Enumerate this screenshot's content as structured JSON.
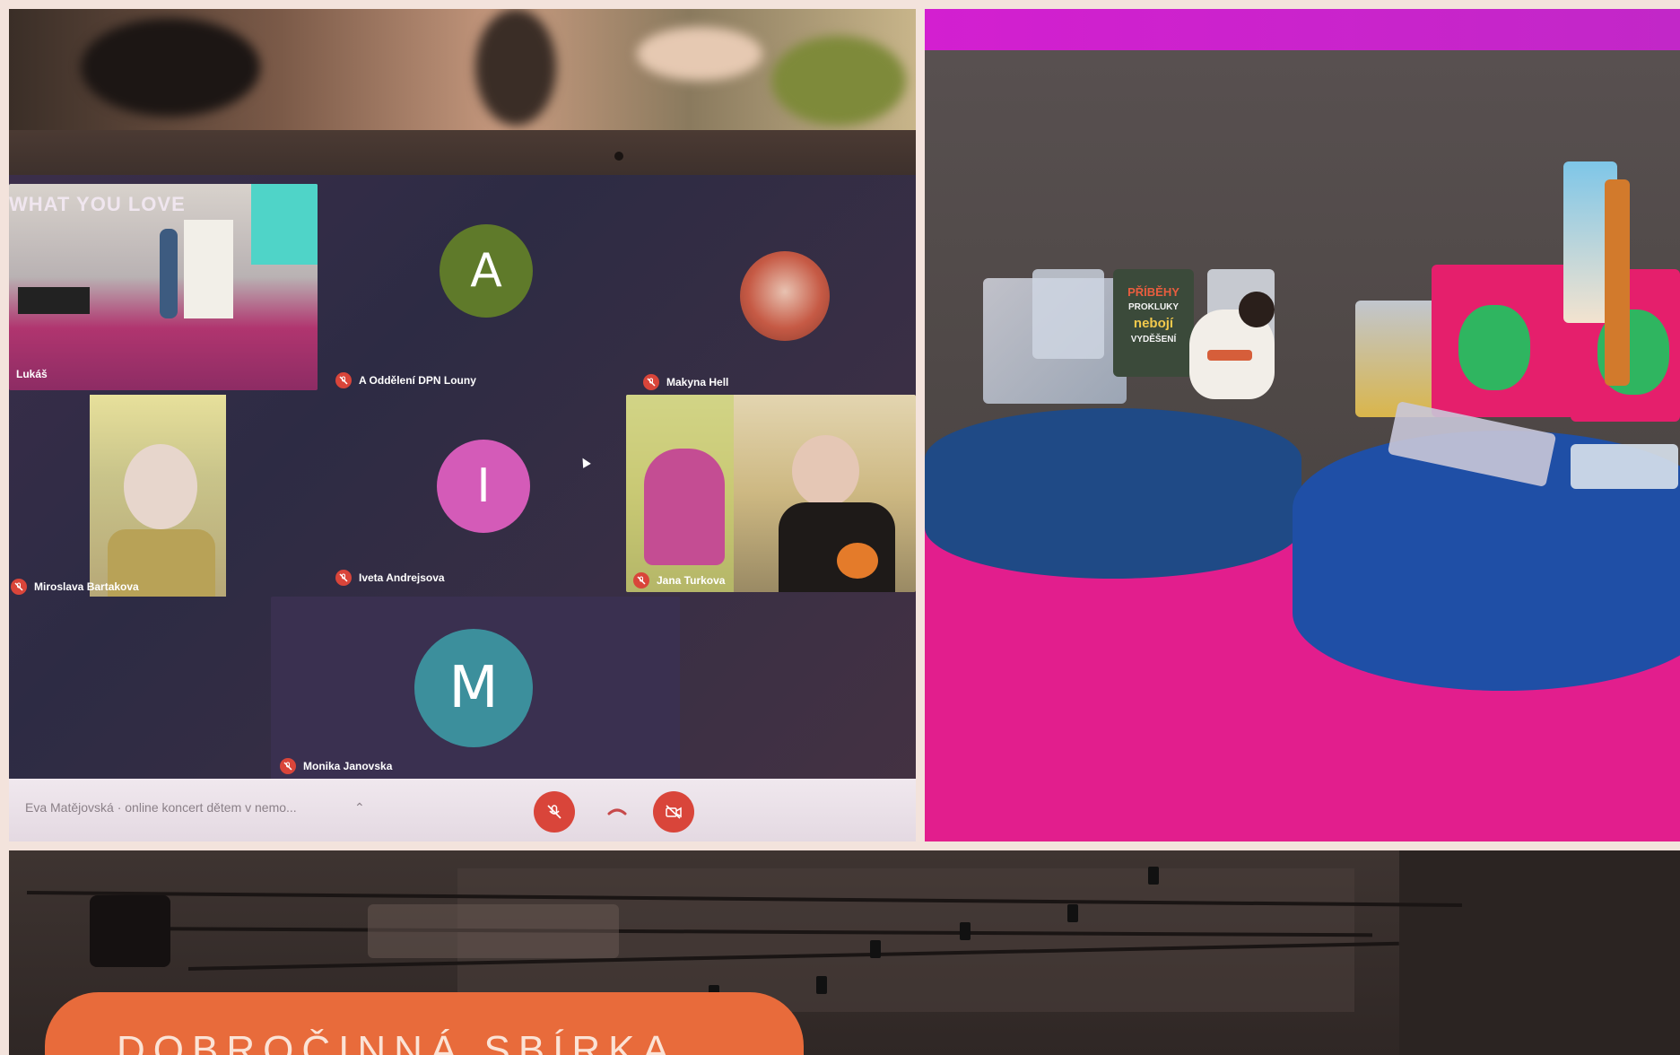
{
  "video_call": {
    "meeting_title": "Eva Matějovská · online koncert dětem v nemo...",
    "participants": [
      {
        "name": "Lukáš"
      },
      {
        "name": "A Oddělení DPN Louny",
        "initial": "A",
        "color": "#5f7a2a"
      },
      {
        "name": "Makyna Hell"
      },
      {
        "name": "Miroslava Bartakova"
      },
      {
        "name": "Iveta Andrejsova",
        "initial": "I",
        "color": "#d45bb8"
      },
      {
        "name": "Jana Turkova"
      },
      {
        "name": "Monika Janovska",
        "initial": "M",
        "color": "#3c8f9c"
      }
    ],
    "stage_sign": "WHAT YOU LOVE",
    "controls": [
      "mic-off-icon",
      "hang-up-icon",
      "camera-off-icon"
    ]
  },
  "gifts_photo": {
    "book_lines": [
      "PŘÍBĚHY",
      "PROKLUKY",
      "nebojí",
      "VYDĚŠENÍ"
    ]
  },
  "banner": {
    "text": "DOBROČINNÁ SBÍRKA"
  },
  "colors": {
    "banner": "#e86b3b",
    "banner_text": "#fbe3d6",
    "stage_floor": "#e21e8d",
    "bench": "#1f4fa6",
    "mic_off": "#d9453a"
  }
}
